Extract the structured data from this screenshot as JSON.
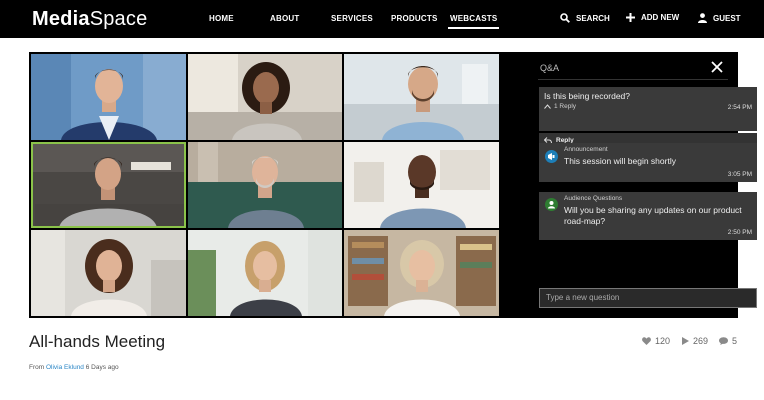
{
  "brand": {
    "logo_bold": "Media",
    "logo_light": "Space"
  },
  "nav": {
    "items": [
      "HOME",
      "ABOUT",
      "SERVICES",
      "PRODUCTS",
      "WEBCASTS"
    ],
    "active": "WEBCASTS",
    "search_label": "SEARCH",
    "add_new_label": "ADD NEW",
    "guest_label": "GUEST"
  },
  "qa": {
    "title": "Q&A",
    "question": {
      "text": "Is this being recorded?",
      "replies_label": "1 Reply",
      "time": "2:54 PM",
      "reply_button": "Reply"
    },
    "announcement": {
      "label": "Announcement",
      "text": "This session will begin shortly",
      "time": "3:05 PM"
    },
    "audience": {
      "label": "Audience Questions",
      "text": "Will you be sharing any updates on our product road-map?",
      "time": "2:50 PM"
    },
    "input_placeholder": "Type a new question"
  },
  "media": {
    "title": "All-hands Meeting",
    "from_label": "From",
    "author": "Olivia Eklund",
    "age": "6 Days ago",
    "likes": "120",
    "plays": "269",
    "comments": "5"
  },
  "colors": {
    "active_speaker": "#8bc34a",
    "author_link": "#2a86c6"
  }
}
